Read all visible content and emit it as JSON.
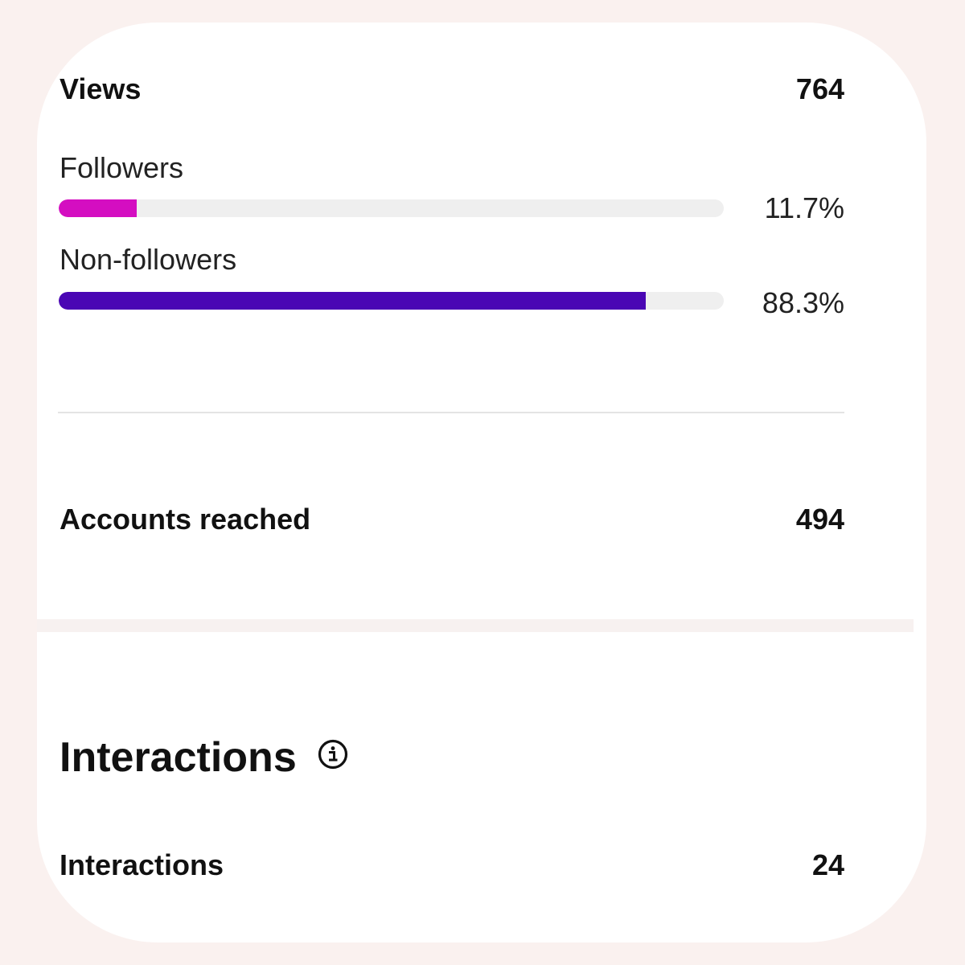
{
  "views": {
    "label": "Views",
    "value": "764",
    "breakdown": [
      {
        "label": "Followers",
        "percent_text": "11.7%",
        "fraction": 0.117,
        "color": "#d40ec1"
      },
      {
        "label": "Non-followers",
        "percent_text": "88.3%",
        "fraction": 0.883,
        "color": "#4a06b4"
      }
    ]
  },
  "accounts_reached": {
    "label": "Accounts reached",
    "value": "494"
  },
  "interactions_section": {
    "title": "Interactions",
    "info_icon": "info-icon",
    "interactions": {
      "label": "Interactions",
      "value": "24"
    }
  },
  "colors": {
    "page_background": "#faf1ef",
    "card_background": "#ffffff",
    "track": "#efefef"
  }
}
